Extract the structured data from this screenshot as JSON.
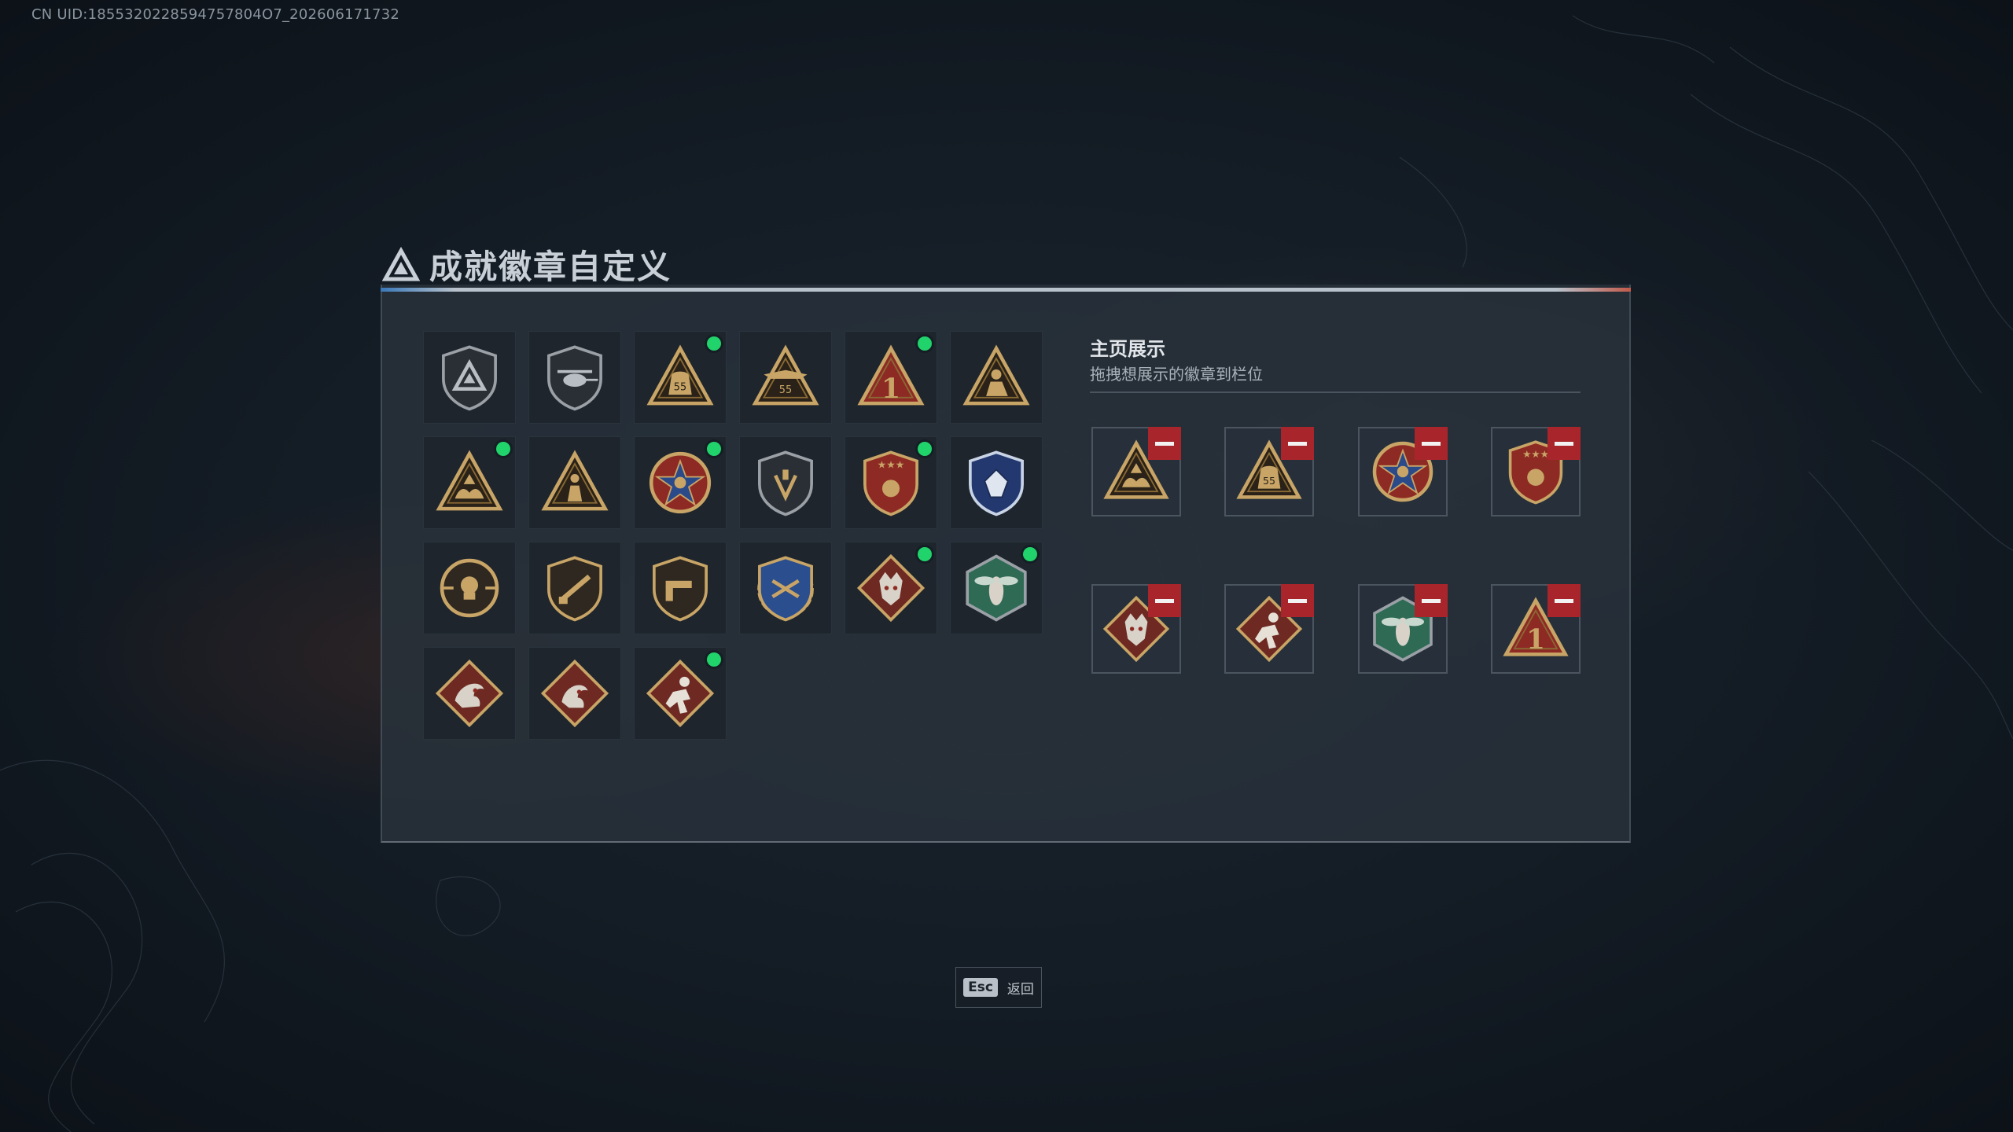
{
  "uid_text": "CN UID:1855320228594757804O7_202606171732",
  "title": "成就徽章自定义",
  "showcase": {
    "title": "主页展示",
    "subtitle": "拖拽想展示的徽章到栏位"
  },
  "footer": {
    "esc_key": "Esc",
    "esc_label": "返回"
  },
  "colors": {
    "panel_bg": "#28313a",
    "gold": "#c8a566",
    "new_dot": "#21d36b",
    "remove": "#a8262b",
    "accent_blue": "#3a78b8",
    "accent_red": "#c25a4a"
  },
  "badge_grid": [
    {
      "icon": "triangle-shield-badge-icon",
      "new": false
    },
    {
      "icon": "helicopter-shield-badge-icon",
      "new": false
    },
    {
      "icon": "bag-55-triangle-badge-icon",
      "new": true
    },
    {
      "icon": "winged-55-triangle-badge-icon",
      "new": false
    },
    {
      "icon": "number-one-triangle-badge-icon",
      "new": true
    },
    {
      "icon": "soldier-triangle-badge-icon",
      "new": false
    },
    {
      "icon": "hands-triangle-badge-icon",
      "new": true
    },
    {
      "icon": "figure-triangle-badge-icon",
      "new": false
    },
    {
      "icon": "star-wreath-badge-icon",
      "new": true
    },
    {
      "icon": "shield-emblem-badge-icon",
      "new": false
    },
    {
      "icon": "crest-stars-badge-icon",
      "new": true
    },
    {
      "icon": "blue-crystal-crest-badge-icon",
      "new": false
    },
    {
      "icon": "skull-circle-badge-icon",
      "new": false
    },
    {
      "icon": "rifle-shield-badge-icon",
      "new": false
    },
    {
      "icon": "pistol-shield-badge-icon",
      "new": false
    },
    {
      "icon": "blue-wreath-crest-badge-icon",
      "new": false
    },
    {
      "icon": "wolf-diamond-badge-icon",
      "new": true
    },
    {
      "icon": "hornet-hexagon-badge-icon",
      "new": true
    },
    {
      "icon": "dragon-diamond-badge-icon",
      "new": false
    },
    {
      "icon": "dragon-diamond-alt-badge-icon",
      "new": false
    },
    {
      "icon": "runner-diamond-badge-icon",
      "new": true
    }
  ],
  "showcase_slots": [
    {
      "icon": "hands-triangle-badge-icon"
    },
    {
      "icon": "bag-55-triangle-badge-icon"
    },
    {
      "icon": "star-wreath-badge-icon"
    },
    {
      "icon": "crest-stars-badge-icon"
    },
    {
      "icon": "wolf-diamond-badge-icon"
    },
    {
      "icon": "runner-diamond-badge-icon"
    },
    {
      "icon": "hornet-hexagon-badge-icon"
    },
    {
      "icon": "number-one-triangle-badge-icon"
    }
  ]
}
